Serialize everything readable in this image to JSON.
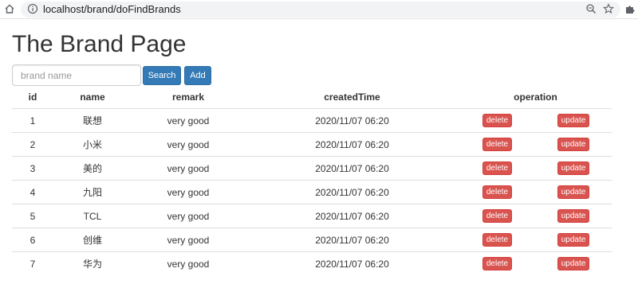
{
  "browser": {
    "url": "localhost/brand/doFindBrands"
  },
  "page": {
    "title": "The Brand Page"
  },
  "toolbar": {
    "search_placeholder": "brand name",
    "search_label": "Search",
    "add_label": "Add"
  },
  "table": {
    "columns": [
      "id",
      "name",
      "remark",
      "createdTime",
      "operation"
    ],
    "delete_label": "delete",
    "update_label": "update",
    "rows": [
      {
        "id": "1",
        "name": "联想",
        "remark": "very good",
        "createdTime": "2020/11/07 06:20"
      },
      {
        "id": "2",
        "name": "小米",
        "remark": "very good",
        "createdTime": "2020/11/07 06:20"
      },
      {
        "id": "3",
        "name": "美的",
        "remark": "very good",
        "createdTime": "2020/11/07 06:20"
      },
      {
        "id": "4",
        "name": "九阳",
        "remark": "very good",
        "createdTime": "2020/11/07 06:20"
      },
      {
        "id": "5",
        "name": "TCL",
        "remark": "very good",
        "createdTime": "2020/11/07 06:20"
      },
      {
        "id": "6",
        "name": "创维",
        "remark": "very good",
        "createdTime": "2020/11/07 06:20"
      },
      {
        "id": "7",
        "name": "华为",
        "remark": "very good",
        "createdTime": "2020/11/07 06:20"
      }
    ]
  },
  "icons": {
    "home": "home-icon",
    "info": "info-icon",
    "zoom": "zoom-icon",
    "star": "star-icon",
    "extensions": "puzzle-icon"
  },
  "colors": {
    "primary": "#337ab7",
    "danger": "#d9534f"
  }
}
